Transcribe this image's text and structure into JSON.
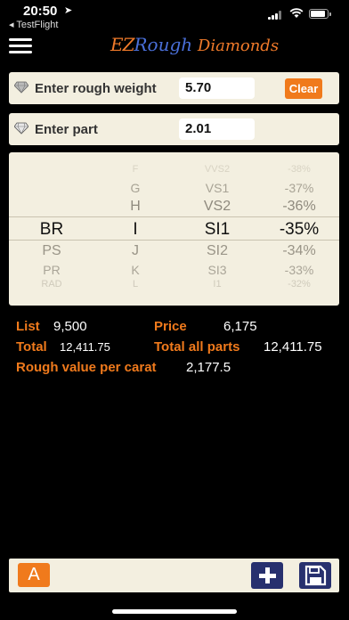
{
  "status_bar": {
    "time": "20:50",
    "back_app": "◂ TestFlight"
  },
  "header": {
    "brand_ez": "EZ",
    "brand_rough": "Rough",
    "brand_diamonds": " Diamonds"
  },
  "inputs": {
    "rough_weight_label": "Enter rough weight",
    "rough_weight_value": "5.70",
    "clear_label": "Clear",
    "part_label": "Enter part",
    "part_value": "2.01"
  },
  "picker": {
    "rows": [
      {
        "shape": "",
        "color": "F",
        "clarity": "VVS2",
        "discount": "-38%"
      },
      {
        "shape": "",
        "color": "G",
        "clarity": "VS1",
        "discount": "-37%"
      },
      {
        "shape": "",
        "color": "H",
        "clarity": "VS2",
        "discount": "-36%"
      },
      {
        "shape": "BR",
        "color": "I",
        "clarity": "SI1",
        "discount": "-35%"
      },
      {
        "shape": "PS",
        "color": "J",
        "clarity": "SI2",
        "discount": "-34%"
      },
      {
        "shape": "PR",
        "color": "K",
        "clarity": "SI3",
        "discount": "-33%"
      },
      {
        "shape": "RAD",
        "color": "L",
        "clarity": "I1",
        "discount": "-32%"
      }
    ],
    "selected_index": 3
  },
  "results": {
    "list_label": "List",
    "list_value": "9,500",
    "price_label": "Price",
    "price_value": "6,175",
    "total_label": "Total",
    "total_value": "12,411.75",
    "total_all_label": "Total all parts",
    "total_all_value": "12,411.75",
    "rough_label": "Rough value per carat",
    "rough_value": "2,177.5"
  },
  "bottom_bar": {
    "a_label": "A"
  },
  "colors": {
    "accent": "#f07a1c",
    "panel": "#f3efe0",
    "button_dark": "#27306e",
    "brand_blue": "#4a6fd8"
  }
}
